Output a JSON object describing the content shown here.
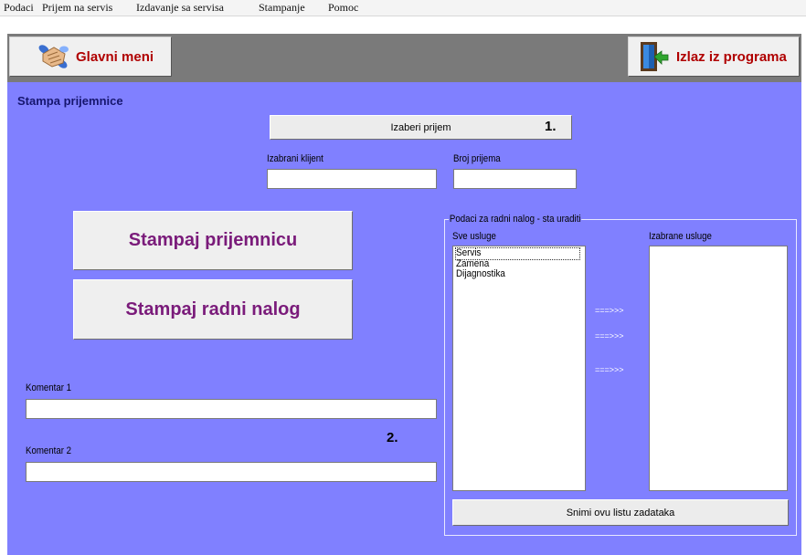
{
  "menu": [
    "Podaci",
    "Prijem na servis",
    "Izdavanje sa servisa",
    "Stampanje",
    "Pomoc"
  ],
  "toolbar": {
    "main_menu_label": "Glavni meni",
    "exit_label": "Izlaz iz programa"
  },
  "form": {
    "title": "Stampa prijemnice",
    "select_button": "Izaberi prijem",
    "step1": "1.",
    "client_label": "Izabrani klijent",
    "client_value": "",
    "receipt_no_label": "Broj prijema",
    "receipt_no_value": "",
    "print_receipt_button": "Stampaj prijemnicu",
    "print_order_button": "Stampaj radni nalog",
    "comment1_label": "Komentar 1",
    "comment1_value": "",
    "comment2_label": "Komentar 2",
    "comment2_value": "",
    "step2": "2."
  },
  "work_order": {
    "group_label": "Podaci za radni nalog - sta uraditi",
    "all_services_label": "Sve usluge",
    "selected_services_label": "Izabrane usluge",
    "all_services": [
      "Servis",
      "Zamena",
      "Dijagnostika"
    ],
    "selected_index": 0,
    "selected_services": [],
    "arrows": [
      "===>>>",
      "===>>>",
      "===>>>"
    ],
    "save_button": "Snimi ovu listu zadataka"
  },
  "colors": {
    "panel": "#8080ff",
    "toolbar": "#7a7a7a",
    "big_button_text": "#7a1b7a",
    "toolbar_button_text": "#b00000"
  }
}
